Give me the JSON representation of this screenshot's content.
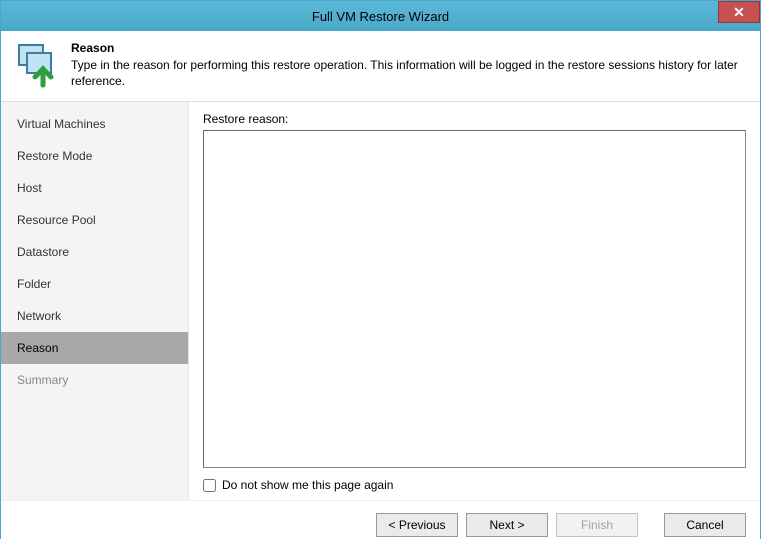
{
  "window": {
    "title": "Full VM Restore Wizard",
    "close_glyph": "✕"
  },
  "header": {
    "title": "Reason",
    "desc": "Type in the reason for performing this restore operation. This information will be logged in the restore sessions history for later reference."
  },
  "sidebar": {
    "items": [
      {
        "label": "Virtual Machines",
        "selected": false,
        "muted": false
      },
      {
        "label": "Restore Mode",
        "selected": false,
        "muted": false
      },
      {
        "label": "Host",
        "selected": false,
        "muted": false
      },
      {
        "label": "Resource Pool",
        "selected": false,
        "muted": false
      },
      {
        "label": "Datastore",
        "selected": false,
        "muted": false
      },
      {
        "label": "Folder",
        "selected": false,
        "muted": false
      },
      {
        "label": "Network",
        "selected": false,
        "muted": false
      },
      {
        "label": "Reason",
        "selected": true,
        "muted": false
      },
      {
        "label": "Summary",
        "selected": false,
        "muted": true
      }
    ]
  },
  "main": {
    "field_label": "Restore reason:",
    "reason_value": "",
    "checkbox_label": "Do not show me this page again",
    "checkbox_checked": false
  },
  "footer": {
    "previous": "< Previous",
    "next": "Next >",
    "finish": "Finish",
    "cancel": "Cancel",
    "finish_enabled": false
  }
}
